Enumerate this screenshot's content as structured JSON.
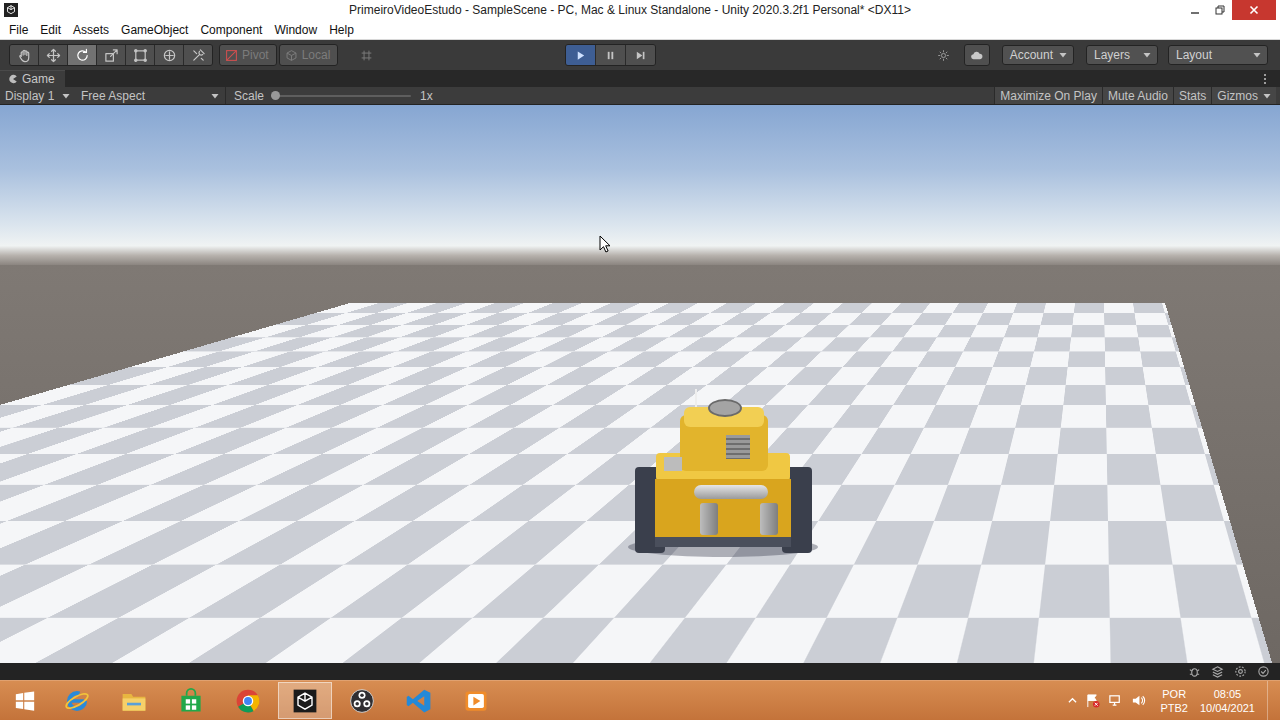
{
  "window": {
    "title": "PrimeiroVideoEstudo - SampleScene - PC, Mac & Linux Standalone - Unity 2020.3.2f1 Personal* <DX11>"
  },
  "menu": [
    "File",
    "Edit",
    "Assets",
    "GameObject",
    "Component",
    "Window",
    "Help"
  ],
  "toolbar": {
    "tools": [
      {
        "kind": "hand",
        "selected": false
      },
      {
        "kind": "move",
        "selected": false
      },
      {
        "kind": "rotate",
        "selected": true
      },
      {
        "kind": "scale",
        "selected": false
      },
      {
        "kind": "rect",
        "selected": false
      },
      {
        "kind": "transform",
        "selected": false
      },
      {
        "kind": "custom",
        "selected": false
      }
    ],
    "handles": [
      {
        "label": "Pivot",
        "kind": "pivot"
      },
      {
        "label": "Local",
        "kind": "local"
      }
    ],
    "playback": [
      {
        "kind": "play",
        "selected": true
      },
      {
        "kind": "pause",
        "selected": false
      },
      {
        "kind": "step",
        "selected": false
      }
    ],
    "dropdowns": [
      "Account",
      "Layers",
      "Layout"
    ]
  },
  "panel": {
    "tab": "Game",
    "display": "Display 1",
    "aspect": "Free Aspect",
    "scale_label": "Scale",
    "scale": {
      "level": 0.03,
      "reading": "1x"
    },
    "toggles": [
      {
        "label": "Maximize On Play",
        "selected": false,
        "kind": "toggle"
      },
      {
        "label": "Mute Audio",
        "selected": false,
        "kind": "toggle"
      },
      {
        "label": "Stats",
        "selected": false,
        "kind": "toggle"
      },
      {
        "label": "Gizmos",
        "selected": false,
        "kind": "dropdown"
      }
    ]
  },
  "taskbar": {
    "apps": [
      {
        "kind": "ie",
        "selected": false
      },
      {
        "kind": "explorer",
        "selected": false
      },
      {
        "kind": "store",
        "selected": false
      },
      {
        "kind": "chrome",
        "selected": false
      },
      {
        "kind": "unity",
        "selected": true
      },
      {
        "kind": "obs",
        "selected": false
      },
      {
        "kind": "code",
        "selected": false
      },
      {
        "kind": "player",
        "selected": false
      }
    ],
    "tray": {
      "language": "POR",
      "layout": "PTB2",
      "time": "08:05",
      "date": "10/04/2021"
    }
  }
}
